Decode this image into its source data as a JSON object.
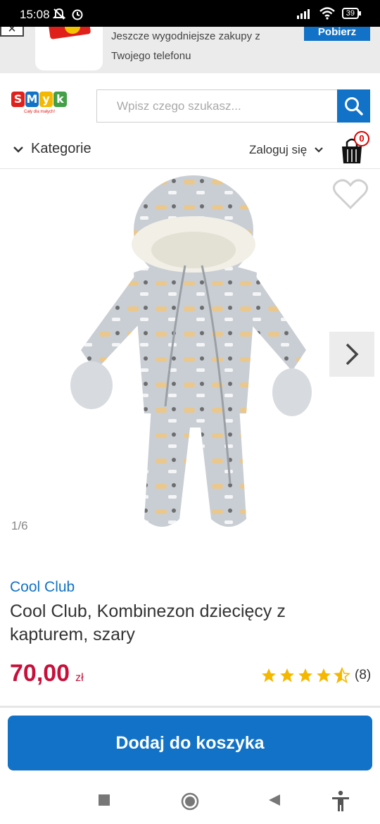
{
  "status_bar": {
    "time": "15:08",
    "battery": "39"
  },
  "app_banner": {
    "text_line1": "Jeszcze wygodniejsze zakupy z",
    "text_line2": "Twojego telefonu",
    "open_label": "Pobierz",
    "close_label": "×"
  },
  "header": {
    "logo_letters": [
      "S",
      "M",
      "y",
      "k"
    ],
    "logo_tagline": "Cały dla małych!",
    "search_placeholder": "Wpisz czego szukasz...",
    "categories_label": "Kategorie",
    "login_label": "Zaloguj się",
    "cart_count": "0"
  },
  "gallery": {
    "counter": "1/6"
  },
  "product": {
    "brand": "Cool Club",
    "title": "Cool Club, Kombinezon dziecięcy z kapturem, szary",
    "price": "70,00",
    "currency": "zł",
    "rating_stars": 4.5,
    "review_count": "(8)"
  },
  "actions": {
    "add_to_cart": "Dodaj do koszyka"
  },
  "colors": {
    "accent": "#1172c7",
    "price": "#c7103a",
    "star": "#f5b800"
  }
}
